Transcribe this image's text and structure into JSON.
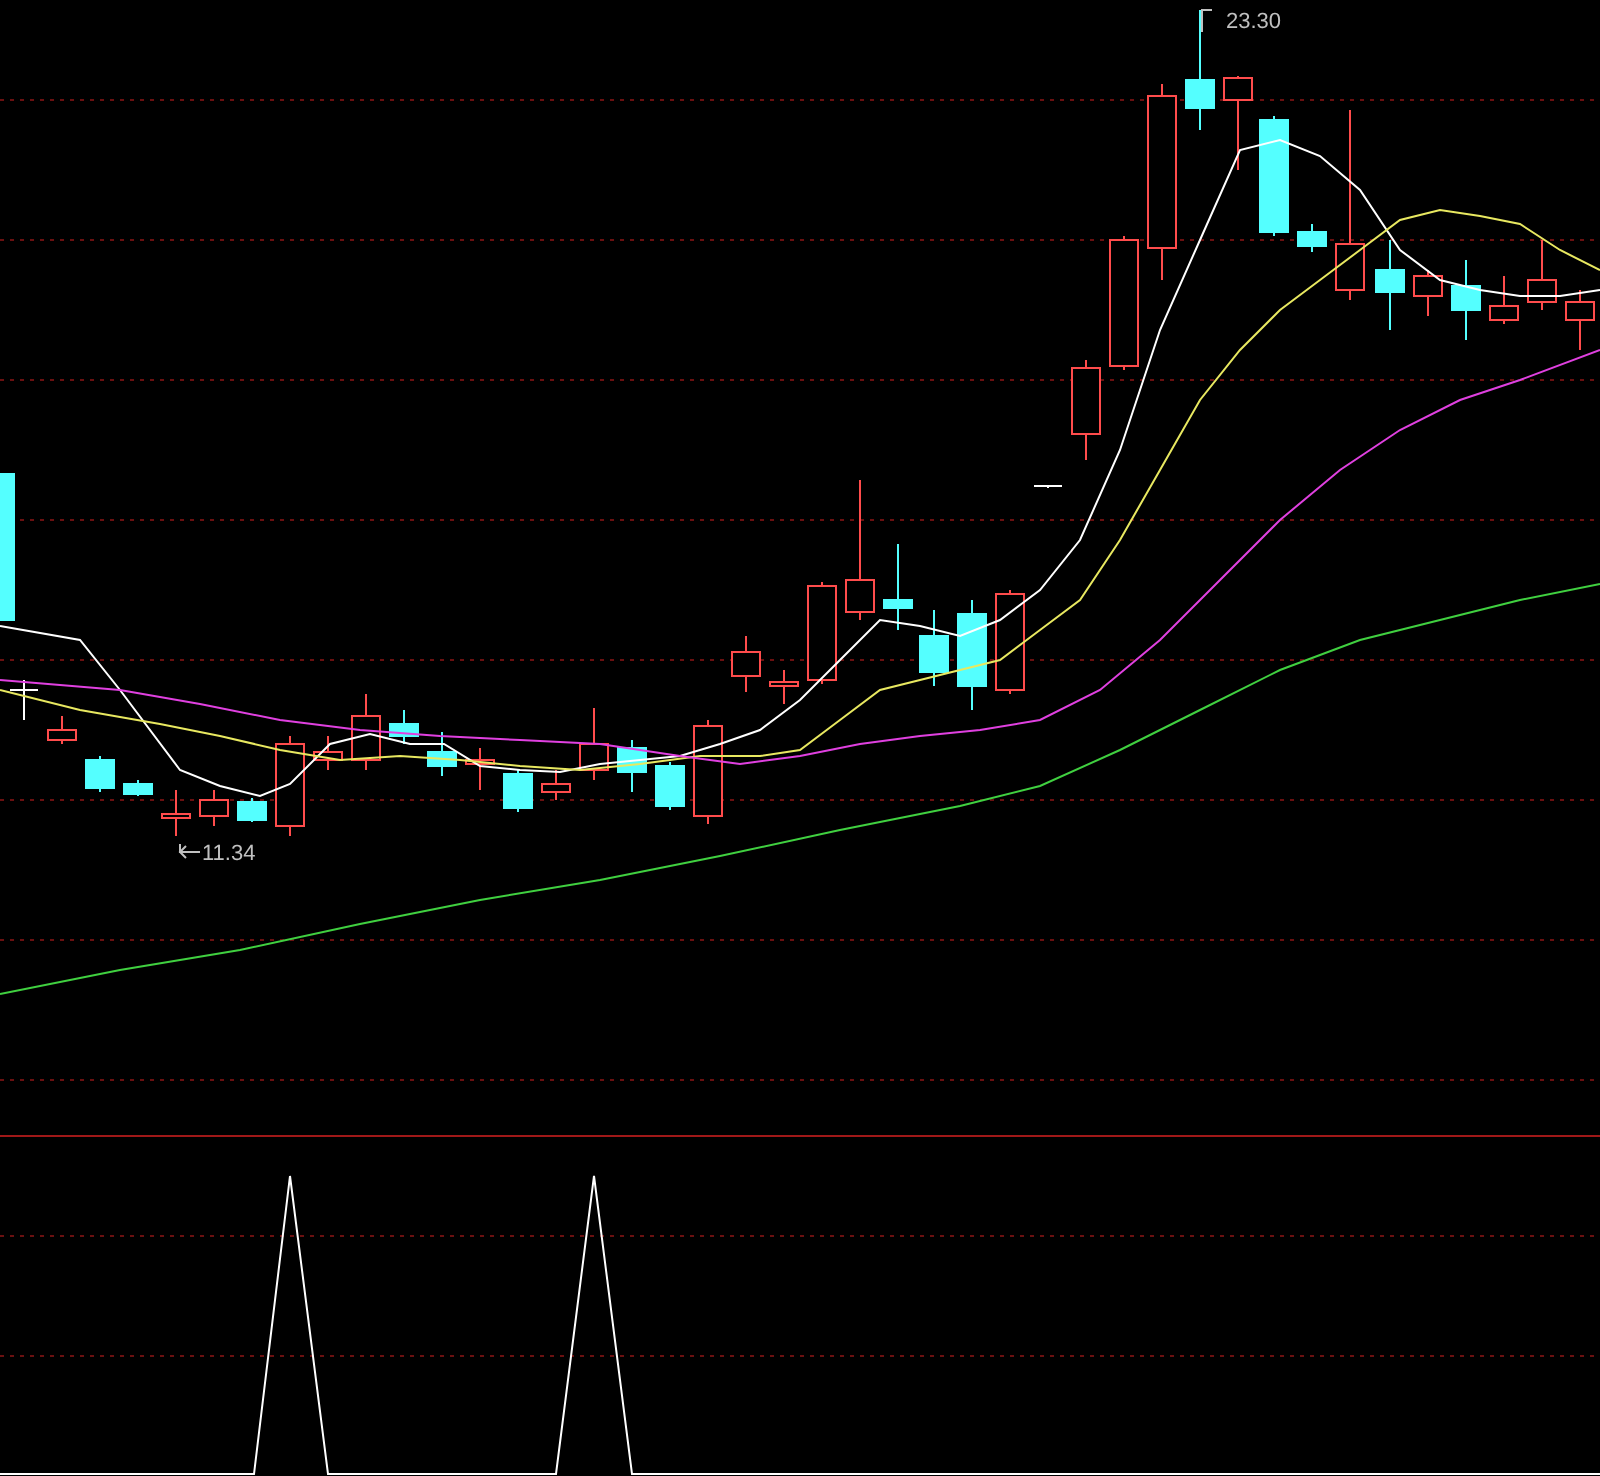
{
  "chart": {
    "high_label": "23.30",
    "low_label": "11.34"
  }
}
